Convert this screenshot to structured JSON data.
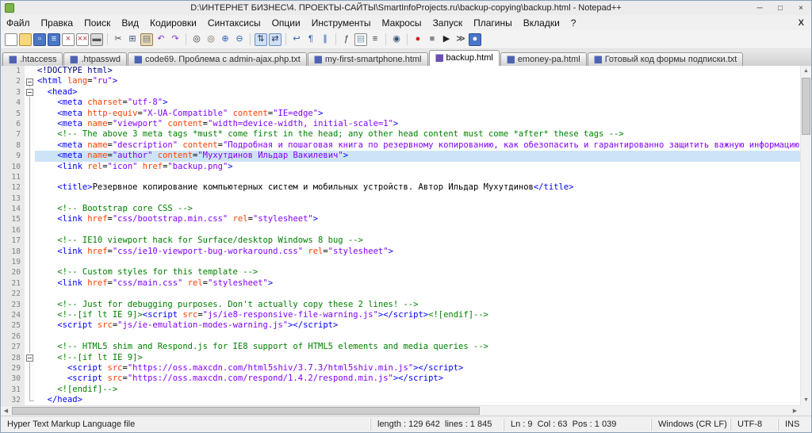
{
  "window": {
    "title": "D:\\ИНТЕРНЕТ БИЗНЕС\\4. ПРОЕКТЫ-САЙТЫ\\SmartInfoProjects.ru\\backup-copying\\backup.html - Notepad++",
    "controls": {
      "minimize": "─",
      "maximize": "□",
      "close": "×"
    }
  },
  "menu": {
    "items": [
      "Файл",
      "Правка",
      "Поиск",
      "Вид",
      "Кодировки",
      "Синтаксисы",
      "Опции",
      "Инструменты",
      "Макросы",
      "Запуск",
      "Плагины",
      "Вкладки",
      "?"
    ],
    "close_x": "X"
  },
  "toolbar": {
    "icons": [
      {
        "name": "new-file",
        "bg": "#ffffff",
        "bd": "#8a8a8a",
        "g": "",
        "gc": ""
      },
      {
        "name": "open-folder",
        "bg": "#f5d87c",
        "bd": "#b8912f",
        "g": "",
        "gc": ""
      },
      {
        "name": "save",
        "bg": "#4a76c6",
        "bd": "#2d4f91",
        "g": "▫",
        "gc": "#ffffff"
      },
      {
        "name": "save-all",
        "bg": "#4a76c6",
        "bd": "#2d4f91",
        "g": "≡",
        "gc": "#ffffff"
      },
      {
        "name": "close",
        "bg": "#ffffff",
        "bd": "#8a8a8a",
        "g": "×",
        "gc": "#c33333"
      },
      {
        "name": "close-all",
        "bg": "#ffffff",
        "bd": "#8a8a8a",
        "g": "××",
        "gc": "#c33333"
      },
      {
        "name": "print",
        "bg": "#dcdcdc",
        "bd": "#7d7d7d",
        "g": "▬",
        "gc": "#555555"
      },
      {
        "sep": true
      },
      {
        "name": "cut",
        "g": "✂",
        "gc": "#444444"
      },
      {
        "name": "copy",
        "g": "⊞",
        "gc": "#44557a"
      },
      {
        "name": "paste",
        "bg": "#e8d9b8",
        "bd": "#9a7d4a",
        "g": "▤",
        "gc": "#777777"
      },
      {
        "name": "undo",
        "g": "↶",
        "gc": "#8833cc"
      },
      {
        "name": "redo",
        "g": "↷",
        "gc": "#8833cc"
      },
      {
        "sep": true
      },
      {
        "name": "find",
        "g": "◎",
        "gc": "#333333"
      },
      {
        "name": "replace",
        "g": "◎",
        "gc": "#776655"
      },
      {
        "name": "zoom-in",
        "g": "⊕",
        "gc": "#2a5db0"
      },
      {
        "name": "zoom-out",
        "g": "⊖",
        "gc": "#2a5db0"
      },
      {
        "sep": true
      },
      {
        "name": "sync-vertical-scrolling",
        "bg": "#cfe0f5",
        "bd": "#6a8fc0",
        "g": "⇅",
        "gc": "#223355"
      },
      {
        "name": "sync-horizontal-scrolling",
        "bg": "#cfe0f5",
        "bd": "#6a8fc0",
        "g": "⇄",
        "gc": "#223355"
      },
      {
        "sep": true
      },
      {
        "name": "word-wrap",
        "g": "↩",
        "gc": "#2a5db0"
      },
      {
        "name": "show-all-characters",
        "g": "¶",
        "gc": "#2a5db0"
      },
      {
        "name": "indent-guide",
        "g": "∥",
        "gc": "#2a5db0"
      },
      {
        "sep": true
      },
      {
        "name": "function-list",
        "g": "ƒ",
        "gc": "#333333"
      },
      {
        "name": "document-map",
        "bg": "#ffffff",
        "bd": "#888888",
        "g": "▤",
        "gc": "#7799aa"
      },
      {
        "name": "document-switcher",
        "g": "≡",
        "gc": "#333333"
      },
      {
        "sep": true
      },
      {
        "name": "monitoring",
        "g": "◉",
        "gc": "#335577"
      },
      {
        "sep": true
      },
      {
        "name": "start-recording",
        "g": "●",
        "gc": "#cc2222"
      },
      {
        "name": "stop-recording",
        "g": "■",
        "gc": "#8a8a8a"
      },
      {
        "name": "playback",
        "g": "▶",
        "gc": "#222222"
      },
      {
        "name": "run-macro-multiple-times",
        "g": "≫",
        "gc": "#222222"
      },
      {
        "name": "save-recorded-macro",
        "bg": "#4a76c6",
        "bd": "#2d4f91",
        "g": "●",
        "gc": "#ffffff"
      }
    ]
  },
  "tabs": [
    {
      "label": ".htaccess",
      "icon_color": "#4f63b5",
      "active": false
    },
    {
      "label": ".htpasswd",
      "icon_color": "#4f63b5",
      "active": false
    },
    {
      "label": "code69. Проблема с admin-ajax.php.txt",
      "icon_color": "#4f63b5",
      "active": false
    },
    {
      "label": "my-first-smartphone.html",
      "icon_color": "#4f63b5",
      "active": false
    },
    {
      "label": "backup.html",
      "icon_color": "#6a4fb5",
      "active": true
    },
    {
      "label": "emoney-pa.html",
      "icon_color": "#4f63b5",
      "active": false
    },
    {
      "label": "Готовый код формы подписки.txt",
      "icon_color": "#4f63b5",
      "active": false
    }
  ],
  "scrollbar": {
    "up": "▲",
    "down": "▼",
    "left": "◀",
    "right": "▶"
  },
  "editor": {
    "colors": {
      "D": "#000000",
      "T": "#0000ff",
      "A": "#ff4000",
      "V": "#8000ff",
      "C": "#008000",
      "G": "#000080"
    },
    "current_line_color": "#cde4f7",
    "lines": [
      {
        "n": 1,
        "f": "",
        "hl": false,
        "t": [
          [
            "G",
            "<!DOCTYPE html>"
          ]
        ]
      },
      {
        "n": 2,
        "f": "box",
        "hl": false,
        "t": [
          [
            "T",
            "<html "
          ],
          [
            "A",
            "lang"
          ],
          [
            "D",
            "="
          ],
          [
            "V",
            "\"ru\""
          ],
          [
            "T",
            ">"
          ]
        ]
      },
      {
        "n": 3,
        "f": "box",
        "hl": false,
        "t": [
          [
            "D",
            "  "
          ],
          [
            "T",
            "<head>"
          ]
        ]
      },
      {
        "n": 4,
        "f": "line",
        "hl": false,
        "t": [
          [
            "D",
            "    "
          ],
          [
            "T",
            "<meta "
          ],
          [
            "A",
            "charset"
          ],
          [
            "D",
            "="
          ],
          [
            "V",
            "\"utf-8\""
          ],
          [
            "T",
            ">"
          ]
        ]
      },
      {
        "n": 5,
        "f": "line",
        "hl": false,
        "t": [
          [
            "D",
            "    "
          ],
          [
            "T",
            "<meta "
          ],
          [
            "A",
            "http-equiv"
          ],
          [
            "D",
            "="
          ],
          [
            "V",
            "\"X-UA-Compatible\""
          ],
          [
            "D",
            " "
          ],
          [
            "A",
            "content"
          ],
          [
            "D",
            "="
          ],
          [
            "V",
            "\"IE=edge\""
          ],
          [
            "T",
            ">"
          ]
        ]
      },
      {
        "n": 6,
        "f": "line",
        "hl": false,
        "t": [
          [
            "D",
            "    "
          ],
          [
            "T",
            "<meta "
          ],
          [
            "A",
            "name"
          ],
          [
            "D",
            "="
          ],
          [
            "V",
            "\"viewport\""
          ],
          [
            "D",
            " "
          ],
          [
            "A",
            "content"
          ],
          [
            "D",
            "="
          ],
          [
            "V",
            "\"width=device-width, initial-scale=1\""
          ],
          [
            "T",
            ">"
          ]
        ]
      },
      {
        "n": 7,
        "f": "line",
        "hl": false,
        "t": [
          [
            "D",
            "    "
          ],
          [
            "C",
            "<!-- The above 3 meta tags *must* come first in the head; any other head content must come *after* these tags -->"
          ]
        ]
      },
      {
        "n": 8,
        "f": "line",
        "hl": false,
        "t": [
          [
            "D",
            "    "
          ],
          [
            "T",
            "<meta "
          ],
          [
            "A",
            "name"
          ],
          [
            "D",
            "="
          ],
          [
            "V",
            "\"description\""
          ],
          [
            "D",
            " "
          ],
          [
            "A",
            "content"
          ],
          [
            "D",
            "="
          ],
          [
            "V",
            "\"Подробная и пошаговая книга по резервному копированию, как обезопасить и гарантированно защитить важную информацию от внез"
          ]
        ]
      },
      {
        "n": 9,
        "f": "line",
        "hl": true,
        "t": [
          [
            "D",
            "    "
          ],
          [
            "T",
            "<meta "
          ],
          [
            "A",
            "name"
          ],
          [
            "D",
            "="
          ],
          [
            "V",
            "\"author\""
          ],
          [
            "D",
            " "
          ],
          [
            "A",
            "content"
          ],
          [
            "D",
            "="
          ],
          [
            "V",
            "\"Мухутдинов Ильдар Вакилевич\""
          ],
          [
            "T",
            ">"
          ]
        ]
      },
      {
        "n": 10,
        "f": "line",
        "hl": false,
        "t": [
          [
            "D",
            "    "
          ],
          [
            "T",
            "<link "
          ],
          [
            "A",
            "rel"
          ],
          [
            "D",
            "="
          ],
          [
            "V",
            "\"icon\""
          ],
          [
            "D",
            " "
          ],
          [
            "A",
            "href"
          ],
          [
            "D",
            "="
          ],
          [
            "V",
            "\"backup.png\""
          ],
          [
            "T",
            ">"
          ]
        ]
      },
      {
        "n": 11,
        "f": "line",
        "hl": false,
        "t": []
      },
      {
        "n": 12,
        "f": "line",
        "hl": false,
        "t": [
          [
            "D",
            "    "
          ],
          [
            "T",
            "<title>"
          ],
          [
            "D",
            "Резервное копирование компьютерных систем и мобильных устройств. Автор Ильдар Мухутдинов"
          ],
          [
            "T",
            "</title>"
          ]
        ]
      },
      {
        "n": 13,
        "f": "line",
        "hl": false,
        "t": []
      },
      {
        "n": 14,
        "f": "line",
        "hl": false,
        "t": [
          [
            "D",
            "    "
          ],
          [
            "C",
            "<!-- Bootstrap core CSS -->"
          ]
        ]
      },
      {
        "n": 15,
        "f": "line",
        "hl": false,
        "t": [
          [
            "D",
            "    "
          ],
          [
            "T",
            "<link "
          ],
          [
            "A",
            "href"
          ],
          [
            "D",
            "="
          ],
          [
            "V",
            "\"css/bootstrap.min.css\""
          ],
          [
            "D",
            " "
          ],
          [
            "A",
            "rel"
          ],
          [
            "D",
            "="
          ],
          [
            "V",
            "\"stylesheet\""
          ],
          [
            "T",
            ">"
          ]
        ]
      },
      {
        "n": 16,
        "f": "line",
        "hl": false,
        "t": []
      },
      {
        "n": 17,
        "f": "line",
        "hl": false,
        "t": [
          [
            "D",
            "    "
          ],
          [
            "C",
            "<!-- IE10 viewport hack for Surface/desktop Windows 8 bug -->"
          ]
        ]
      },
      {
        "n": 18,
        "f": "line",
        "hl": false,
        "t": [
          [
            "D",
            "    "
          ],
          [
            "T",
            "<link "
          ],
          [
            "A",
            "href"
          ],
          [
            "D",
            "="
          ],
          [
            "V",
            "\"css/ie10-viewport-bug-workaround.css\""
          ],
          [
            "D",
            " "
          ],
          [
            "A",
            "rel"
          ],
          [
            "D",
            "="
          ],
          [
            "V",
            "\"stylesheet\""
          ],
          [
            "T",
            ">"
          ]
        ]
      },
      {
        "n": 19,
        "f": "line",
        "hl": false,
        "t": []
      },
      {
        "n": 20,
        "f": "line",
        "hl": false,
        "t": [
          [
            "D",
            "    "
          ],
          [
            "C",
            "<!-- Custom styles for this template -->"
          ]
        ]
      },
      {
        "n": 21,
        "f": "line",
        "hl": false,
        "t": [
          [
            "D",
            "    "
          ],
          [
            "T",
            "<link "
          ],
          [
            "A",
            "href"
          ],
          [
            "D",
            "="
          ],
          [
            "V",
            "\"css/main.css\""
          ],
          [
            "D",
            " "
          ],
          [
            "A",
            "rel"
          ],
          [
            "D",
            "="
          ],
          [
            "V",
            "\"stylesheet\""
          ],
          [
            "T",
            ">"
          ]
        ]
      },
      {
        "n": 22,
        "f": "line",
        "hl": false,
        "t": []
      },
      {
        "n": 23,
        "f": "line",
        "hl": false,
        "t": [
          [
            "D",
            "    "
          ],
          [
            "C",
            "<!-- Just for debugging purposes. Don't actually copy these 2 lines! -->"
          ]
        ]
      },
      {
        "n": 24,
        "f": "line",
        "hl": false,
        "t": [
          [
            "D",
            "    "
          ],
          [
            "C",
            "<!--[if lt IE 9]>"
          ],
          [
            "T",
            "<script "
          ],
          [
            "A",
            "src"
          ],
          [
            "D",
            "="
          ],
          [
            "V",
            "\"js/ie8-responsive-file-warning.js\""
          ],
          [
            "T",
            "></script>"
          ],
          [
            "C",
            "<![endif]-->"
          ]
        ]
      },
      {
        "n": 25,
        "f": "line",
        "hl": false,
        "t": [
          [
            "D",
            "    "
          ],
          [
            "T",
            "<script "
          ],
          [
            "A",
            "src"
          ],
          [
            "D",
            "="
          ],
          [
            "V",
            "\"js/ie-emulation-modes-warning.js\""
          ],
          [
            "T",
            "></script>"
          ]
        ]
      },
      {
        "n": 26,
        "f": "line",
        "hl": false,
        "t": []
      },
      {
        "n": 27,
        "f": "line",
        "hl": false,
        "t": [
          [
            "D",
            "    "
          ],
          [
            "C",
            "<!-- HTML5 shim and Respond.js for IE8 support of HTML5 elements and media queries -->"
          ]
        ]
      },
      {
        "n": 28,
        "f": "box",
        "hl": false,
        "t": [
          [
            "D",
            "    "
          ],
          [
            "C",
            "<!--[if lt IE 9]>"
          ]
        ]
      },
      {
        "n": 29,
        "f": "line",
        "hl": false,
        "t": [
          [
            "D",
            "      "
          ],
          [
            "T",
            "<script "
          ],
          [
            "A",
            "src"
          ],
          [
            "D",
            "="
          ],
          [
            "V",
            "\"https://oss.maxcdn.com/html5shiv/3.7.3/html5shiv.min.js\""
          ],
          [
            "T",
            "></script>"
          ]
        ]
      },
      {
        "n": 30,
        "f": "line",
        "hl": false,
        "t": [
          [
            "D",
            "      "
          ],
          [
            "T",
            "<script "
          ],
          [
            "A",
            "src"
          ],
          [
            "D",
            "="
          ],
          [
            "V",
            "\"https://oss.maxcdn.com/respond/1.4.2/respond.min.js\""
          ],
          [
            "T",
            "></script>"
          ]
        ]
      },
      {
        "n": 31,
        "f": "line",
        "hl": false,
        "t": [
          [
            "D",
            "    "
          ],
          [
            "C",
            "<![endif]-->"
          ]
        ]
      },
      {
        "n": 32,
        "f": "end",
        "hl": false,
        "t": [
          [
            "D",
            "  "
          ],
          [
            "T",
            "</head>"
          ]
        ]
      }
    ]
  },
  "status": {
    "doc_type": "Hyper Text Markup Language file",
    "length_info": "length : 129 642  lines : 1 845",
    "caret_info": "Ln : 9  Col : 63  Pos : 1 039",
    "eol": "Windows (CR LF)",
    "encoding": "UTF-8",
    "mode": "INS"
  }
}
